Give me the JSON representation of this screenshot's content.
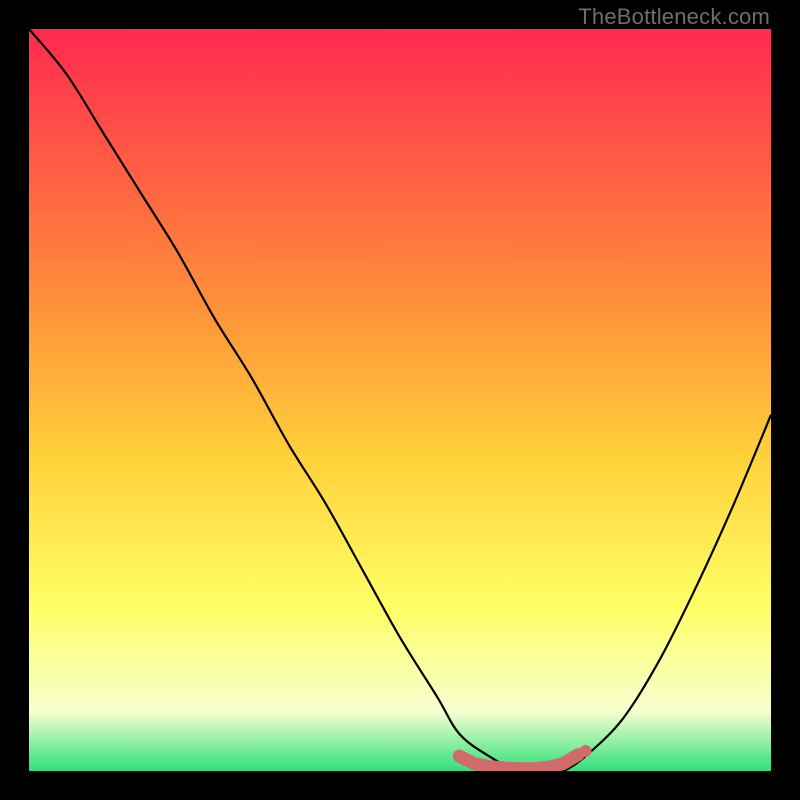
{
  "watermark": "TheBottleneck.com",
  "colors": {
    "top": "#ff2a4f",
    "mid1": "#ff8a3a",
    "mid2": "#ffd23a",
    "mid3": "#ffff66",
    "mid4": "#f6ffd0",
    "bottom": "#2fe07a",
    "frame": "#000000",
    "curve": "#000000",
    "marker": "#d16a6a"
  },
  "chart_data": {
    "type": "line",
    "title": "",
    "xlabel": "",
    "ylabel": "",
    "xlim": [
      0,
      100
    ],
    "ylim": [
      0,
      100
    ],
    "grid": false,
    "legend": null,
    "annotations": [],
    "series": [
      {
        "name": "bottleneck-curve",
        "x": [
          0,
          5,
          10,
          15,
          20,
          25,
          30,
          35,
          40,
          45,
          50,
          55,
          58,
          62,
          66,
          70,
          72,
          75,
          80,
          85,
          90,
          95,
          100
        ],
        "y": [
          100,
          94,
          86,
          78,
          70,
          61,
          53,
          44,
          36,
          27,
          18,
          10,
          5,
          2,
          0,
          0,
          0,
          2,
          7,
          15,
          25,
          36,
          48
        ]
      }
    ],
    "optimal_markers": {
      "name": "optimal-range",
      "color": "#d16a6a",
      "x": [
        58,
        60,
        62,
        64,
        66,
        68,
        70,
        72,
        74
      ],
      "y": [
        2.0,
        1.0,
        0.6,
        0.4,
        0.3,
        0.3,
        0.5,
        1.0,
        2.2
      ]
    }
  }
}
